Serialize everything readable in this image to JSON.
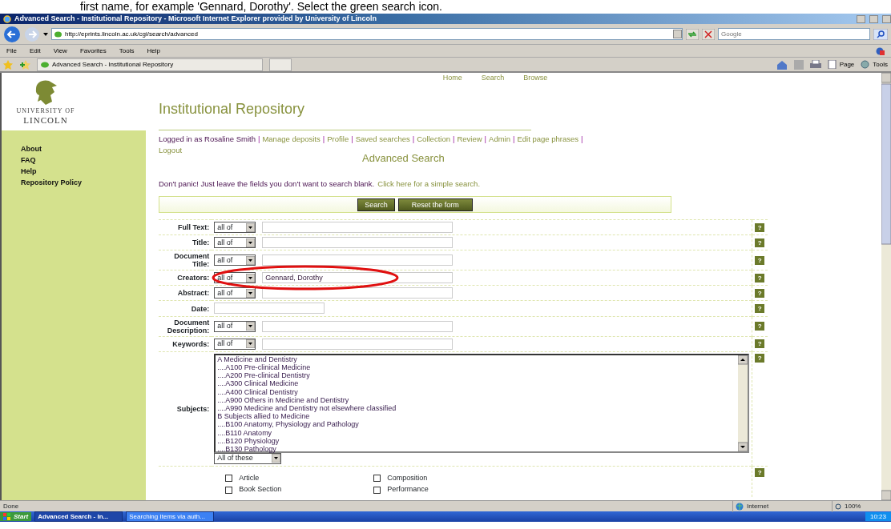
{
  "caption": "first name, for example 'Gennard, Dorothy'. Select the green search icon.",
  "window": {
    "title": "Advanced Search - Institutional Repository - Microsoft Internet Explorer provided by University of Lincoln"
  },
  "address_bar": {
    "url": "http://eprints.lincoln.ac.uk/cgi/search/advanced"
  },
  "search_box": {
    "placeholder": "Google"
  },
  "menu": [
    "File",
    "Edit",
    "View",
    "Favorites",
    "Tools",
    "Help"
  ],
  "tab": {
    "label": "Advanced Search - Institutional Repository"
  },
  "command_bar": [
    "Page",
    "Tools"
  ],
  "page": {
    "top_nav": [
      "Home",
      "Search",
      "Browse"
    ],
    "logo": {
      "line1": "UNIVERSITY OF",
      "line2": "LINCOLN"
    },
    "sidebar": [
      "About",
      "FAQ",
      "Help",
      "Repository Policy"
    ],
    "heading": "Institutional Repository",
    "logged_in": "Logged in as Rosaline Smith",
    "separator": "|",
    "user_links": [
      "Manage deposits",
      "Profile",
      "Saved searches",
      "Collection",
      "Review",
      "Admin",
      "Edit page phrases",
      "Logout"
    ],
    "section_title": "Advanced Search",
    "intro": "Don't panic! Just leave the fields you don't want to search blank.",
    "intro_link": "Click here for a simple search.",
    "buttons": [
      "Search",
      "Reset the form"
    ],
    "fields": [
      {
        "kind": "text",
        "label": "Full Text:",
        "match": "all of",
        "help": "?"
      },
      {
        "kind": "text",
        "label": "Title:",
        "match": "all of",
        "help": "?"
      },
      {
        "kind": "text",
        "label": "Document Title:",
        "match": "all of",
        "help": "?"
      },
      {
        "kind": "text",
        "label": "Creators:",
        "match": "all of",
        "value": "Gennard, Dorothy",
        "help": "?"
      },
      {
        "kind": "text",
        "label": "Abstract:",
        "match": "all of",
        "help": "?"
      },
      {
        "kind": "date",
        "label": "Date:",
        "help": "?"
      },
      {
        "kind": "text",
        "label": "Document Description:",
        "match": "all of",
        "help": "?"
      },
      {
        "kind": "text",
        "label": "Keywords:",
        "match": "all of",
        "help": "?"
      },
      {
        "kind": "subjects",
        "label": "Subjects:",
        "match": "All of these",
        "help": "?",
        "options": [
          "A Medicine and Dentistry",
          "....A100 Pre-clinical Medicine",
          "....A200 Pre-clinical Dentistry",
          "....A300 Clinical Medicine",
          "....A400 Clinical Dentistry",
          "....A900 Others in Medicine and Dentistry",
          "....A990 Medicine and Dentistry not elsewhere classified",
          "B Subjects allied to Medicine",
          "....B100 Anatomy, Physiology and Pathology",
          "....B110 Anatomy",
          "....B120 Physiology",
          "....B130 Pathology"
        ]
      },
      {
        "kind": "types",
        "help": "?",
        "types": [
          {
            "label": "Article",
            "checked": false
          },
          {
            "label": "Composition",
            "checked": false
          },
          {
            "label": "Book Section",
            "checked": false
          },
          {
            "label": "Performance",
            "checked": false
          }
        ]
      }
    ]
  },
  "status_bar": {
    "text": "Done",
    "zone": "Internet",
    "zoom": "100%"
  },
  "taskbar": {
    "start": "Start",
    "tasks": [
      {
        "label": "Advanced Search - In...",
        "selected": true
      },
      {
        "label": "Searching Items via auth...",
        "selected": false
      }
    ],
    "clock": "10:23"
  }
}
